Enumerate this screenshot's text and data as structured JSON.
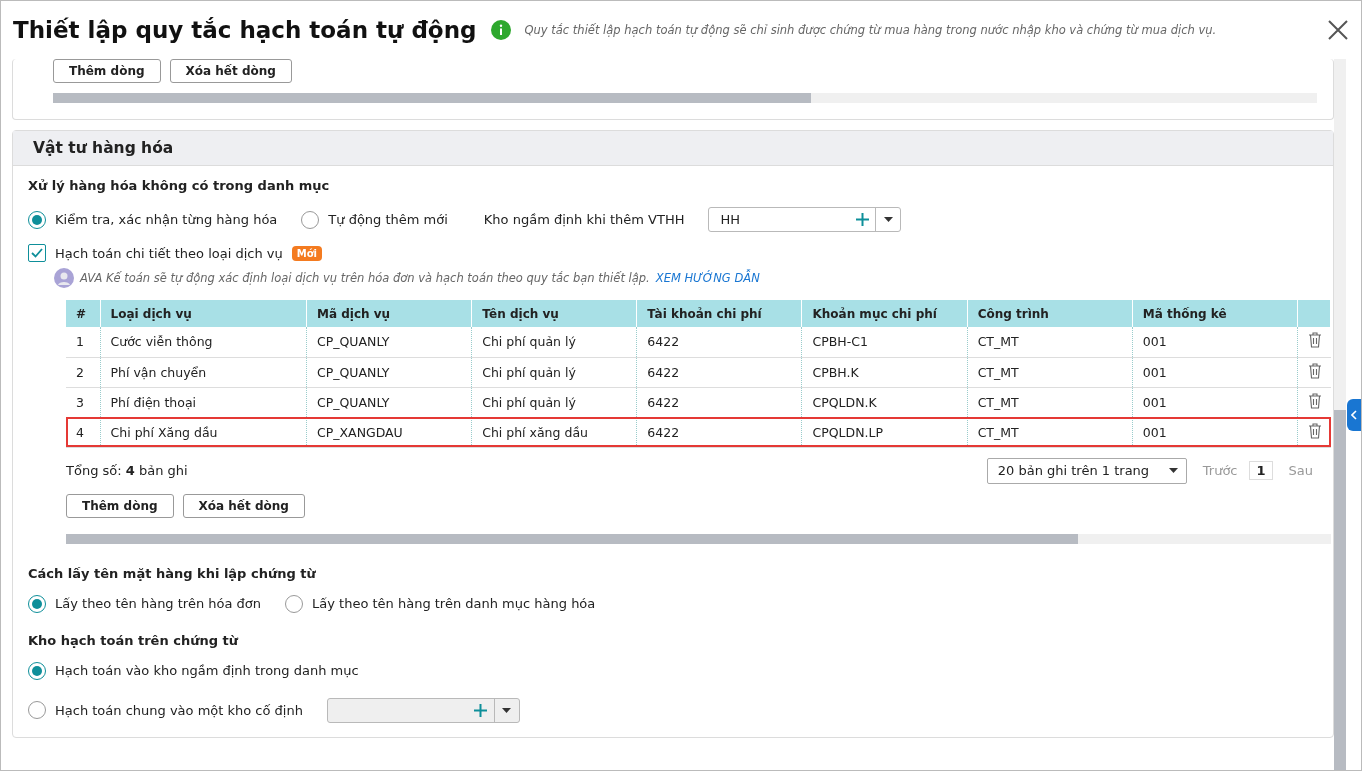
{
  "dialog": {
    "title": "Thiết lập quy tắc hạch toán tự động",
    "info": "Quy tắc thiết lập hạch toán tự động sẽ chỉ sinh được chứng từ mua hàng trong nước nhập kho và chứng từ mua dịch vụ."
  },
  "top_section": {
    "buttons": [
      "Thêm dòng",
      "Xóa hết dòng"
    ]
  },
  "section": {
    "title": "Vật tư hàng hóa",
    "missing_goods": {
      "heading": "Xử lý hàng hóa không có trong danh mục",
      "options": [
        {
          "label": "Kiểm tra, xác nhận từng hàng hóa",
          "selected": true
        },
        {
          "label": "Tự động thêm mới",
          "selected": false
        }
      ],
      "warehouse_label": "Kho ngầm định khi thêm VTHH",
      "warehouse_value": "HH"
    },
    "detail": {
      "label": "Hạch toán chi tiết theo loại dịch vụ",
      "checked": true,
      "badge": "Mới",
      "hint": "AVA Kế toán sẽ tự động xác định loại dịch vụ trên hóa đơn và hạch toán theo quy tắc bạn thiết lập.",
      "link": "XEM HƯỚNG DẪN"
    },
    "table": {
      "columns": [
        "#",
        "Loại dịch vụ",
        "Mã dịch vụ",
        "Tên dịch vụ",
        "Tài khoản chi phí",
        "Khoản mục chi phí",
        "Công trình",
        "Mã thống kê"
      ],
      "rows": [
        {
          "cells": [
            "1",
            "Cước viễn thông",
            "CP_QUANLY",
            "Chi phí quản lý",
            "6422",
            "CPBH-C1",
            "CT_MT",
            "001"
          ],
          "highlighted": false
        },
        {
          "cells": [
            "2",
            "Phí vận chuyển",
            "CP_QUANLY",
            "Chi phí quản lý",
            "6422",
            "CPBH.K",
            "CT_MT",
            "001"
          ],
          "highlighted": false
        },
        {
          "cells": [
            "3",
            "Phí điện thoại",
            "CP_QUANLY",
            "Chi phí quản lý",
            "6422",
            "CPQLDN.K",
            "CT_MT",
            "001"
          ],
          "highlighted": false
        },
        {
          "cells": [
            "4",
            "Chi phí Xăng dầu",
            "CP_XANGDAU",
            "Chi phí xăng dầu",
            "6422",
            "CPQLDN.LP",
            "CT_MT",
            "001"
          ],
          "highlighted": true
        }
      ],
      "total": "Tổng số: **4** bản ghi",
      "page_size": "20 bản ghi trên 1 trang",
      "prev": "Trước",
      "page": "1",
      "next": "Sau"
    },
    "buttons": [
      "Thêm dòng",
      "Xóa hết dòng"
    ],
    "naming": {
      "heading": "Cách lấy tên mặt hàng khi lập chứng từ",
      "options": [
        {
          "label": "Lấy theo tên hàng trên hóa đơn",
          "selected": true
        },
        {
          "label": "Lấy theo tên hàng trên danh mục hàng hóa",
          "selected": false
        }
      ]
    },
    "warehouse": {
      "heading": "Kho hạch toán trên chứng từ",
      "options": [
        {
          "label": "Hạch toán vào kho ngầm định trong danh mục",
          "selected": true
        },
        {
          "label": "Hạch toán chung vào một kho cố định",
          "selected": false
        }
      ]
    }
  }
}
